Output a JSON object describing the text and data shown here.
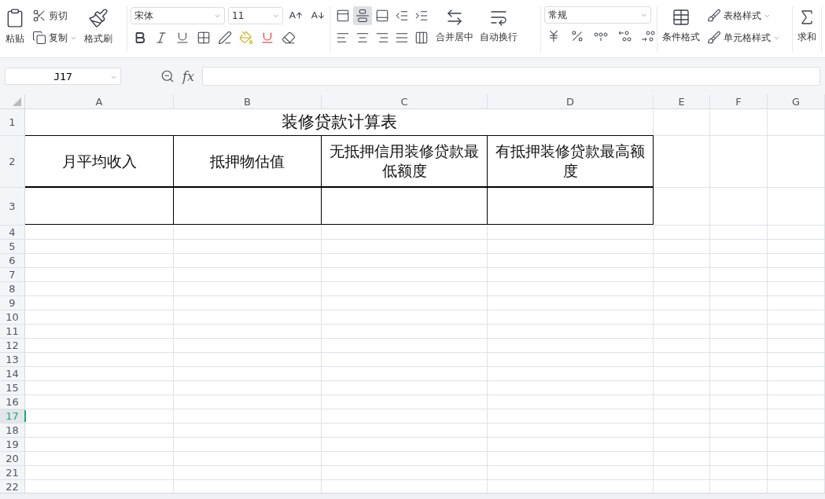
{
  "toolbar": {
    "clipboard": {
      "paste": "粘贴",
      "cut": "剪切",
      "copy": "复制",
      "format_painter": "格式刷"
    },
    "font": {
      "family": "宋体",
      "size": "11"
    },
    "alignment": [
      {
        "kind": "top",
        "selected": false
      },
      {
        "kind": "middle",
        "selected": true
      },
      {
        "kind": "bottom",
        "selected": false
      },
      {
        "kind": "outdent",
        "selected": false
      },
      {
        "kind": "indent",
        "selected": false
      },
      {
        "kind": "left",
        "selected": false
      },
      {
        "kind": "center",
        "selected": false
      },
      {
        "kind": "right",
        "selected": false
      },
      {
        "kind": "justify",
        "selected": false
      },
      {
        "kind": "distributed",
        "selected": false
      }
    ],
    "merge": "合并居中",
    "wrap": "自动换行",
    "number_format": "常规",
    "conditional_format": "条件格式",
    "table_style": "表格样式",
    "cell_style": "单元格样式",
    "sum": "求和"
  },
  "formula_bar": {
    "name_box": "J17",
    "function_label": "fx"
  },
  "sheet": {
    "columns": [
      "A",
      "B",
      "C",
      "D",
      "E",
      "F",
      "G"
    ],
    "rows": [
      {
        "header": "1",
        "kind": "title",
        "selected": false,
        "cells": [
          {
            "text": "装修贷款计算表",
            "bordered": false
          }
        ]
      },
      {
        "header": "2",
        "kind": "header",
        "selected": false,
        "cells": [
          {
            "text": "月平均收入",
            "bordered": true
          },
          {
            "text": "抵押物估值",
            "bordered": true
          },
          {
            "text": "无抵押信用装修贷款最低额度",
            "bordered": true
          },
          {
            "text": "有抵押装修贷款最高额度",
            "bordered": true
          }
        ]
      },
      {
        "header": "3",
        "kind": "data",
        "selected": false,
        "cells": [
          {
            "bordered": true
          },
          {
            "bordered": true
          },
          {
            "bordered": true
          },
          {
            "bordered": true
          }
        ]
      },
      {
        "header": "4",
        "kind": "plain",
        "selected": false
      },
      {
        "header": "5",
        "kind": "plain",
        "selected": false
      },
      {
        "header": "6",
        "kind": "plain",
        "selected": false
      },
      {
        "header": "7",
        "kind": "plain",
        "selected": false
      },
      {
        "header": "8",
        "kind": "plain",
        "selected": false
      },
      {
        "header": "9",
        "kind": "plain",
        "selected": false
      },
      {
        "header": "10",
        "kind": "plain",
        "selected": false
      },
      {
        "header": "11",
        "kind": "plain",
        "selected": false
      },
      {
        "header": "12",
        "kind": "plain",
        "selected": false
      },
      {
        "header": "13",
        "kind": "plain",
        "selected": false
      },
      {
        "header": "14",
        "kind": "plain",
        "selected": false
      },
      {
        "header": "15",
        "kind": "plain",
        "selected": false
      },
      {
        "header": "16",
        "kind": "plain",
        "selected": false
      },
      {
        "header": "17",
        "kind": "plain",
        "selected": true
      },
      {
        "header": "18",
        "kind": "plain",
        "selected": false
      },
      {
        "header": "19",
        "kind": "plain",
        "selected": false
      },
      {
        "header": "20",
        "kind": "plain",
        "selected": false
      },
      {
        "header": "21",
        "kind": "plain",
        "selected": false
      },
      {
        "header": "22",
        "kind": "plain",
        "selected": false
      }
    ]
  }
}
